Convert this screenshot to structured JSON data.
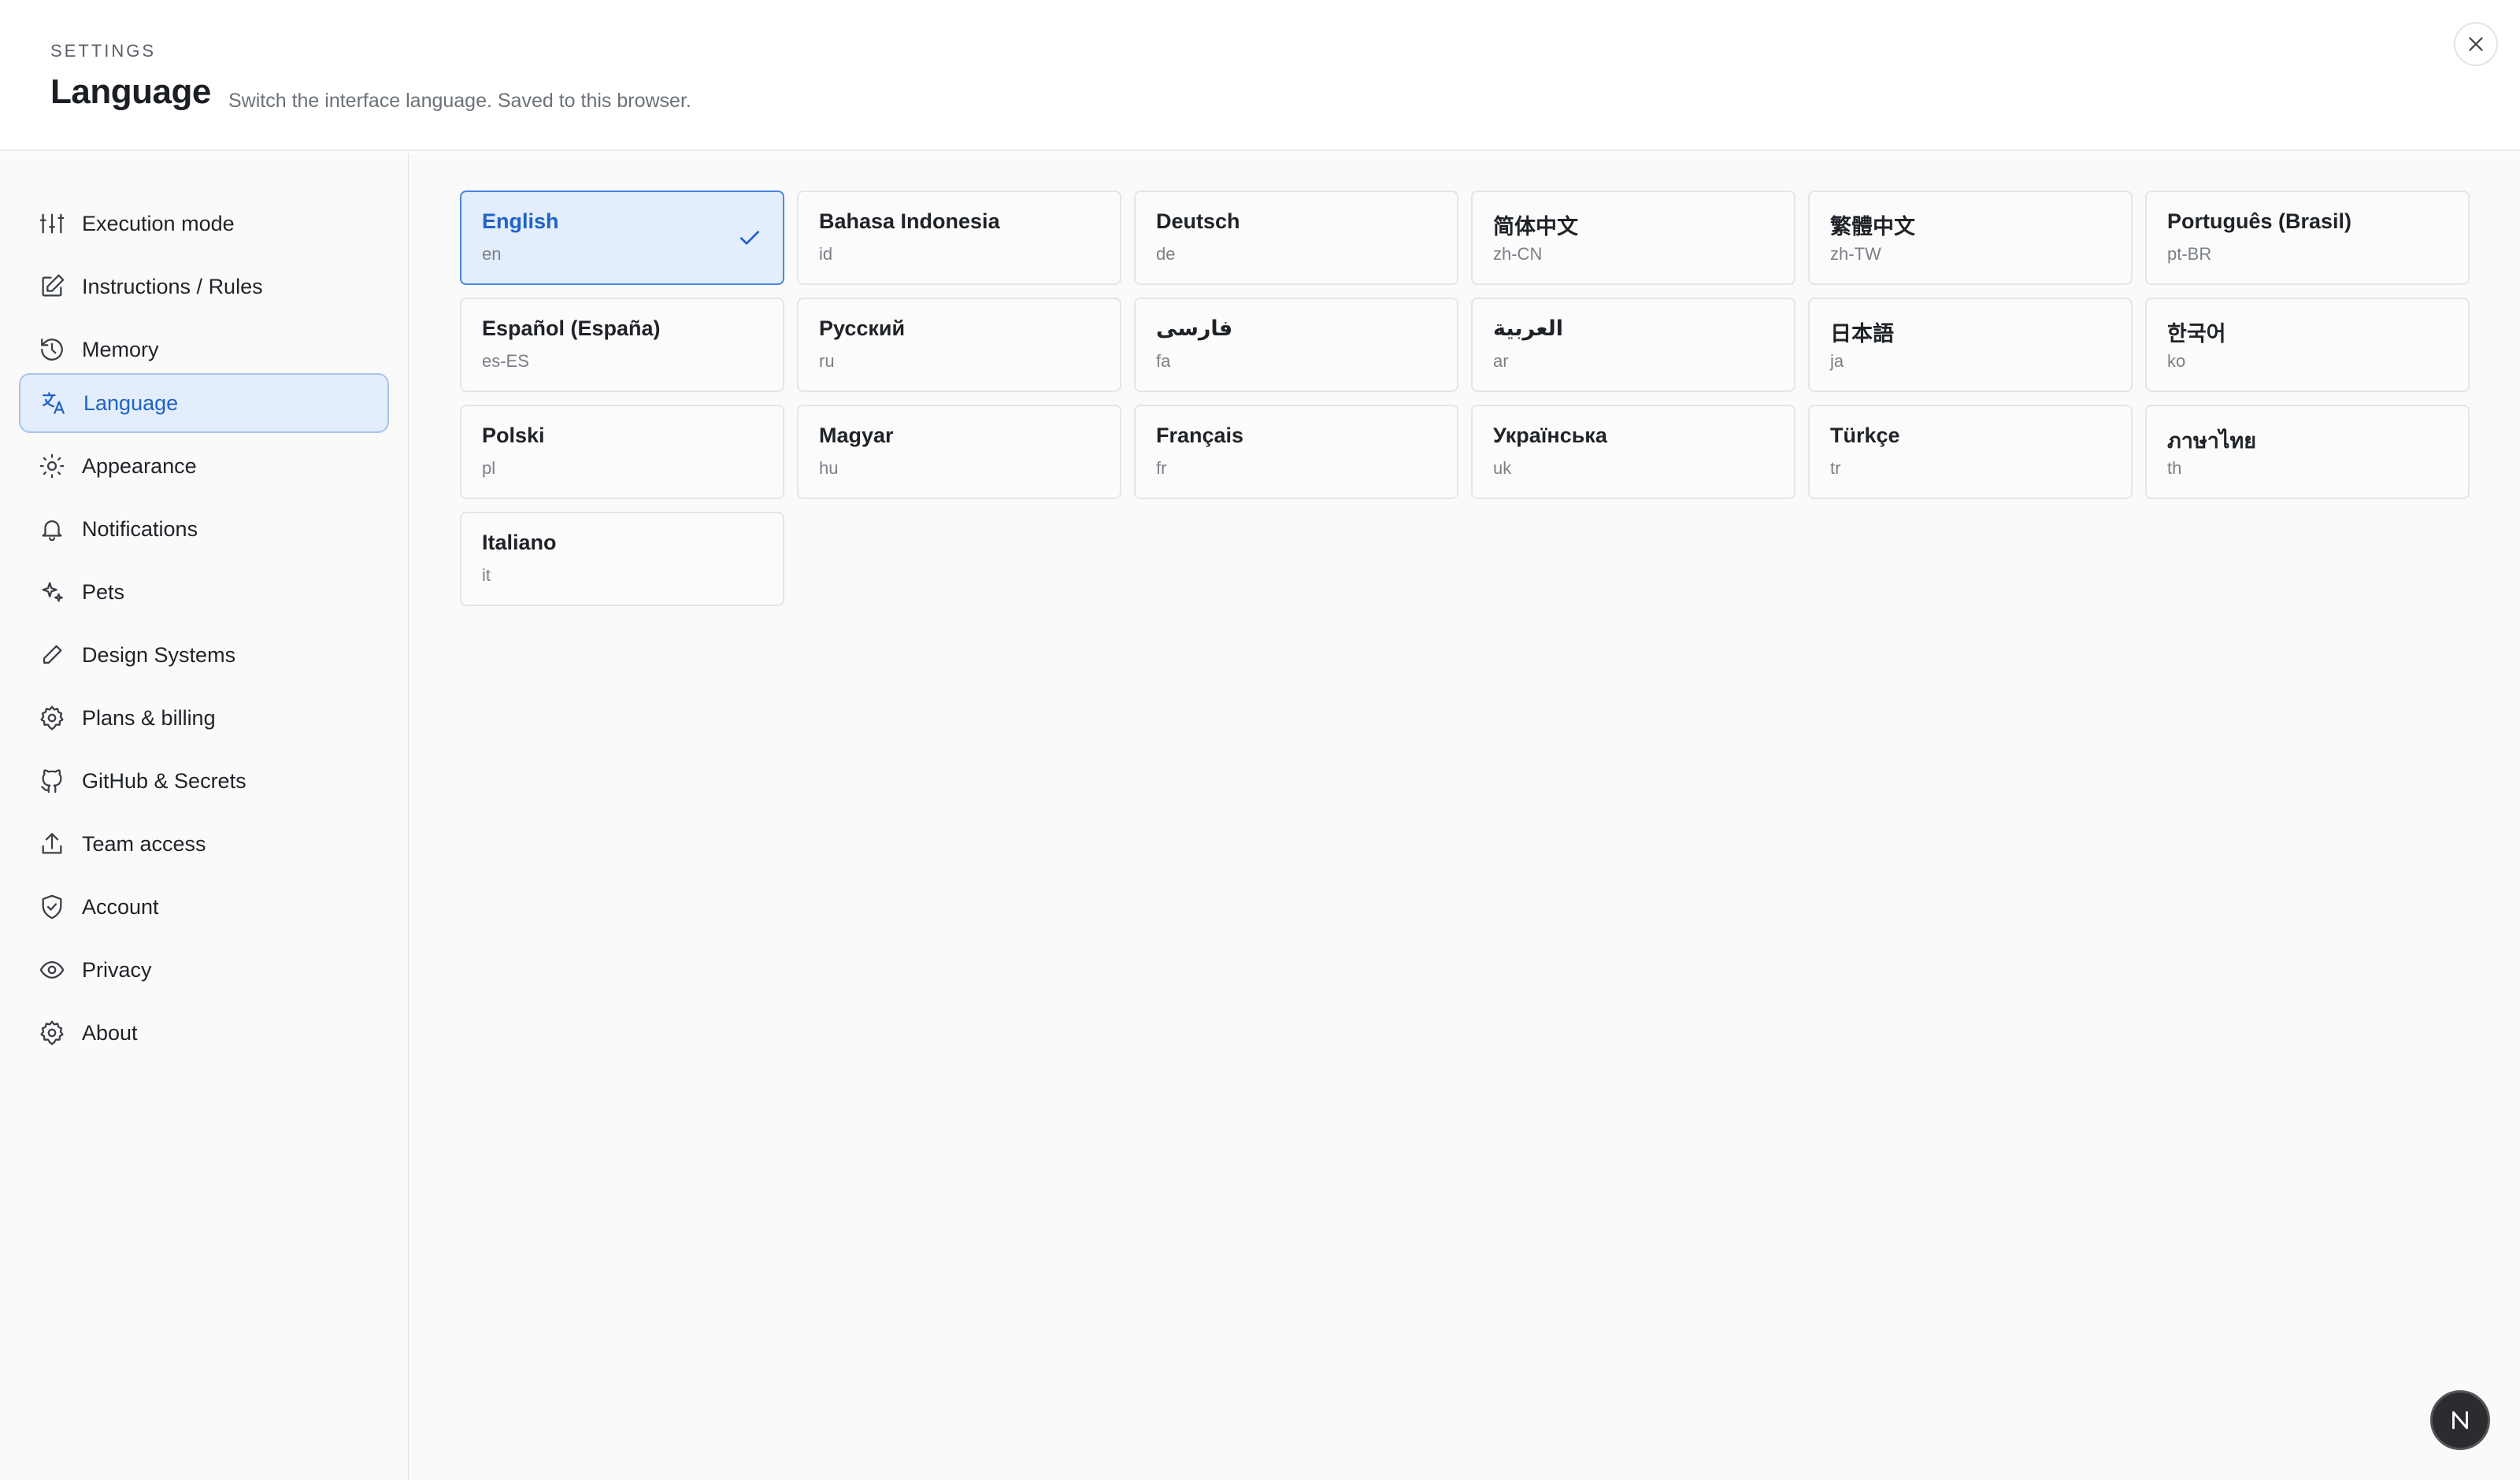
{
  "header": {
    "eyebrow": "SETTINGS",
    "title": "Language",
    "subtitle": "Switch the interface language. Saved to this browser."
  },
  "sidebar": {
    "items": [
      {
        "label": "Execution mode",
        "icon": "sliders-icon"
      },
      {
        "label": "Instructions / Rules",
        "icon": "edit-icon"
      },
      {
        "label": "Memory",
        "icon": "history-icon"
      },
      {
        "label": "Language",
        "icon": "translate-icon",
        "active": true
      },
      {
        "label": "Appearance",
        "icon": "sun-icon"
      },
      {
        "label": "Notifications",
        "icon": "bell-icon"
      },
      {
        "label": "Pets",
        "icon": "sparkles-icon"
      },
      {
        "label": "Design Systems",
        "icon": "pencil-icon"
      },
      {
        "label": "Plans & billing",
        "icon": "gear-icon"
      },
      {
        "label": "GitHub & Secrets",
        "icon": "github-icon"
      },
      {
        "label": "Team access",
        "icon": "share-icon"
      },
      {
        "label": "Account",
        "icon": "shield-check-icon"
      },
      {
        "label": "Privacy",
        "icon": "eye-icon"
      },
      {
        "label": "About",
        "icon": "gear-icon"
      }
    ]
  },
  "languages": [
    {
      "name": "English",
      "code": "en",
      "selected": true
    },
    {
      "name": "Bahasa Indonesia",
      "code": "id"
    },
    {
      "name": "Deutsch",
      "code": "de"
    },
    {
      "name": "简体中文",
      "code": "zh-CN"
    },
    {
      "name": "繁體中文",
      "code": "zh-TW"
    },
    {
      "name": "Português (Brasil)",
      "code": "pt-BR"
    },
    {
      "name": "Español (España)",
      "code": "es-ES"
    },
    {
      "name": "Русский",
      "code": "ru"
    },
    {
      "name": "فارسی",
      "code": "fa"
    },
    {
      "name": "العربية",
      "code": "ar"
    },
    {
      "name": "日本語",
      "code": "ja"
    },
    {
      "name": "한국어",
      "code": "ko"
    },
    {
      "name": "Polski",
      "code": "pl"
    },
    {
      "name": "Magyar",
      "code": "hu"
    },
    {
      "name": "Français",
      "code": "fr"
    },
    {
      "name": "Українська",
      "code": "uk"
    },
    {
      "name": "Türkçe",
      "code": "tr"
    },
    {
      "name": "ภาษาไทย",
      "code": "th"
    },
    {
      "name": "Italiano",
      "code": "it"
    }
  ],
  "colors": {
    "accent": "#1e63c7",
    "selected_bg": "#e3edfb",
    "selected_border": "#4a86df"
  },
  "user_avatar": "N"
}
